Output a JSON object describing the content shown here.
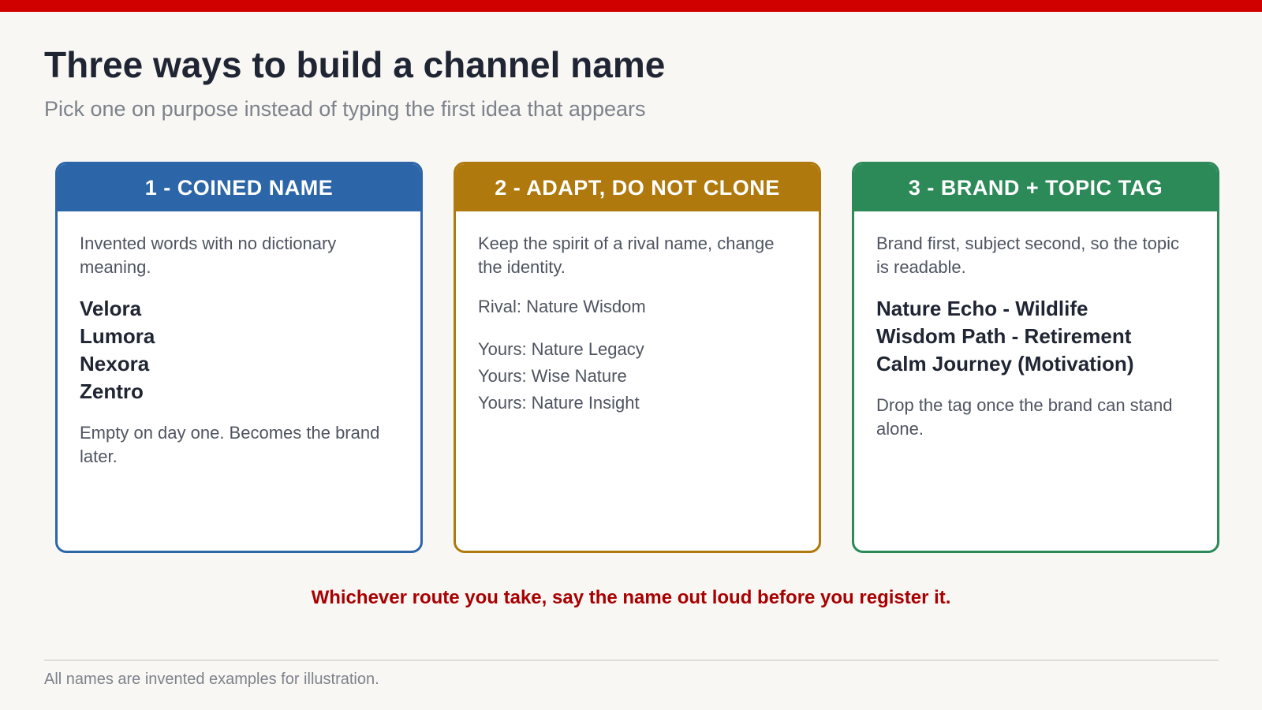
{
  "colors": {
    "top_bar": "#d10000",
    "card_1": "#2c66a8",
    "card_2": "#b0790e",
    "card_3": "#2b8a57",
    "callout": "#a80000"
  },
  "header": {
    "title": "Three ways to build a channel name",
    "subtitle": "Pick one on purpose instead of typing the first idea that appears"
  },
  "cards": [
    {
      "heading": "1 - COINED NAME",
      "description": "Invented words with no dictionary meaning.",
      "names": [
        "Velora",
        "Lumora",
        "Nexora",
        "Zentro"
      ],
      "note": "Empty on day one. Becomes the brand later."
    },
    {
      "heading": "2 - ADAPT, DO NOT CLONE",
      "description": "Keep the spirit of a rival name, change the identity.",
      "rival": "Rival: Nature Wisdom",
      "yours": [
        "Yours: Nature Legacy",
        "Yours: Wise Nature",
        "Yours: Nature Insight"
      ]
    },
    {
      "heading": "3 - BRAND + TOPIC TAG",
      "description": "Brand first, subject second, so the topic is readable.",
      "names": [
        "Nature Echo - Wildlife",
        "Wisdom Path - Retirement",
        "Calm Journey (Motivation)"
      ],
      "note": "Drop the tag once the brand can stand alone."
    }
  ],
  "callout": "Whichever route you take, say the name out loud before you register it.",
  "footnote": "All names are invented examples for illustration."
}
